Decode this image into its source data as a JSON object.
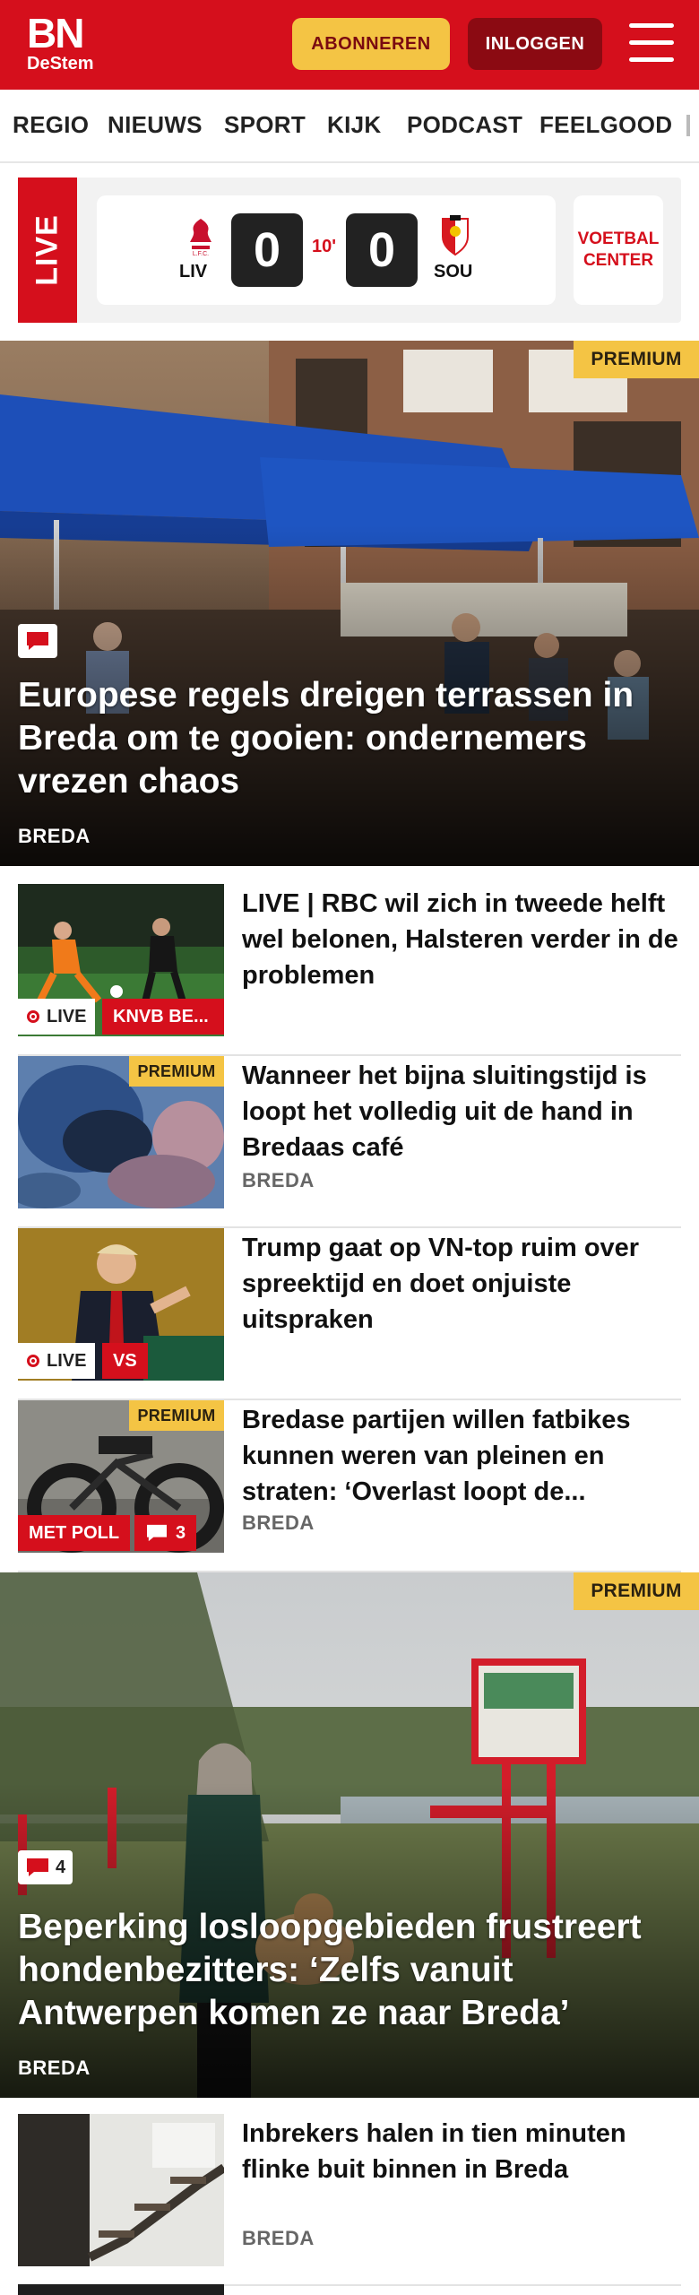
{
  "header": {
    "logo_main": "BN",
    "logo_sub": "DeStem",
    "subscribe_label": "ABONNEREN",
    "login_label": "INLOGGEN",
    "brand_color": "#d50f1c"
  },
  "nav": {
    "items": [
      "REGIO",
      "NIEUWS",
      "SPORT",
      "KIJK",
      "PODCAST",
      "FEELGOOD"
    ]
  },
  "live_match": {
    "live_label": "LIVE",
    "home_team": "LIV",
    "away_team": "SOU",
    "home_score": "0",
    "away_score": "0",
    "minute": "10'",
    "voetbal_center_label": "VOETBAL CENTER"
  },
  "hero1": {
    "premium_label": "PREMIUM",
    "title": "Europese regels dreigen terrassen in Breda om te gooien: ondernemers vrezen chaos",
    "location": "BREDA"
  },
  "articles": [
    {
      "title": "LIVE | RBC wil zich in tweede helft wel belonen, Halsteren verder in de problemen",
      "live_label": "LIVE",
      "chip_label": "KNVB BE..."
    },
    {
      "title": "Wanneer het bijna sluitingstijd is loopt het volledig uit de hand in Bredaas café",
      "premium_label": "PREMIUM",
      "location": "BREDA"
    },
    {
      "title": "Trump gaat op VN-top ruim over spreektijd en doet onjuiste uitspraken",
      "live_label": "LIVE",
      "chip_label": "VS"
    },
    {
      "title": "Bredase partijen willen fatbikes kunnen weren van pleinen en straten: ‘Overlast loopt de...",
      "premium_label": "PREMIUM",
      "poll_label": "MET POLL",
      "comments": "3",
      "location": "BREDA"
    }
  ],
  "hero2": {
    "premium_label": "PREMIUM",
    "comments": "4",
    "title": "Beperking losloopgebieden frustreert hondenbezitters: ‘Zelfs vanuit Antwerpen komen ze naar Breda’",
    "location": "BREDA"
  },
  "article_last": {
    "title": "Inbrekers halen in tien minuten flinke buit binnen in Breda",
    "location": "BREDA"
  }
}
